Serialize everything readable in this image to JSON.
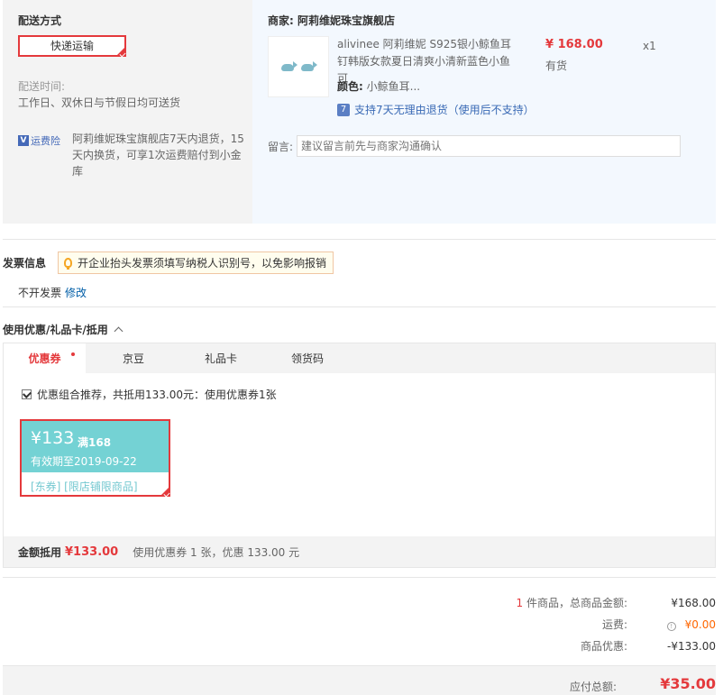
{
  "shipping": {
    "title": "配送方式",
    "method": "快递运输",
    "time_label": "配送时间:",
    "time_value": "工作日、双休日与节假日均可送货",
    "badge": "运费险",
    "badge_letter": "V",
    "insurance_text": "阿莉维妮珠宝旗舰店7天内退货，15天内换货，可享1次运费赔付到小金库"
  },
  "seller": {
    "label": "商家:",
    "name": "阿莉维妮珠宝旗舰店"
  },
  "product": {
    "name": "alivinee 阿莉维妮 S925银小鲸鱼耳钉韩版女款夏日清爽小清新蓝色小鱼可",
    "color_label": "颜色:",
    "color_value": "小鲸鱼耳...",
    "price": "¥ 168.00",
    "stock": "有货",
    "qty": "x1",
    "return_icon": "7",
    "return_policy": "支持7天无理由退货（使用后不支持）"
  },
  "message": {
    "label": "留言:",
    "placeholder": "建议留言前先与商家沟通确认"
  },
  "invoice": {
    "title": "发票信息",
    "tip": "开企业抬头发票须填写纳税人识别号，以免影响报销",
    "status": "不开发票",
    "edit": "修改"
  },
  "coupons": {
    "title": "使用优惠/礼品卡/抵用",
    "tabs": [
      {
        "label": "优惠券"
      },
      {
        "label": "京豆"
      },
      {
        "label": "礼品卡"
      },
      {
        "label": "领货码"
      }
    ],
    "recommend": "优惠组合推荐，共抵用133.00元：使用优惠券1张",
    "card": {
      "amount": "¥133",
      "condition": "满168",
      "expiry": "有效期至2019-09-22",
      "tags": "[东券]  [限店铺限商品]"
    },
    "summary_label": "金额抵用",
    "summary_amount": "¥133.00",
    "summary_desc": "使用优惠券 1 张，优惠 133.00 元"
  },
  "totals": {
    "item_count": "1",
    "item_label": "件商品，总商品金额:",
    "goods_total": "¥168.00",
    "freight_label": "运费:",
    "freight": "¥0.00",
    "discount_label": "商品优惠:",
    "discount": "-¥133.00",
    "pay_label": "应付总额:",
    "pay_total": "¥35.00"
  },
  "colors": {
    "accent": "#e4393c",
    "coupon": "#74d2d4",
    "link": "#005ea7"
  }
}
